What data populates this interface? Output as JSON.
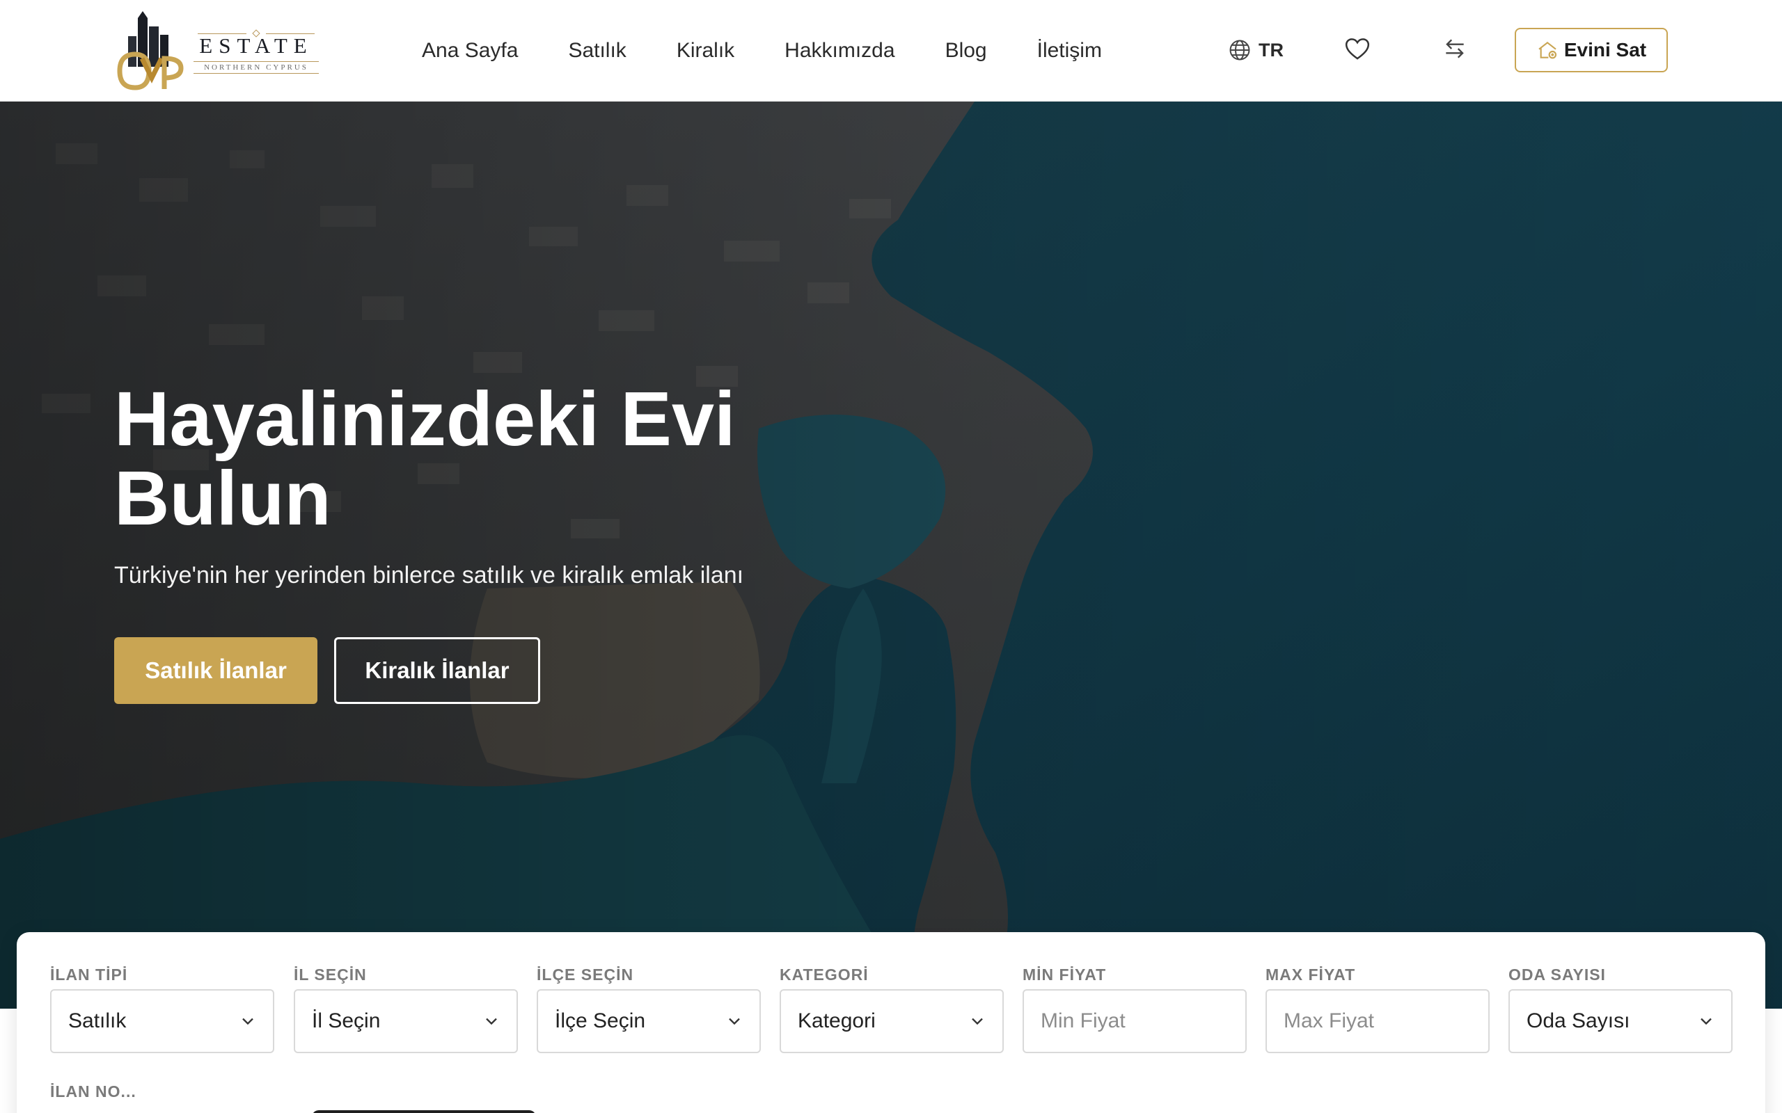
{
  "brand": {
    "name": "ESTATE",
    "subtitle": "NORTHERN CYPRUS",
    "colors": {
      "gold": "#c9a553",
      "dark": "#1a1d24"
    }
  },
  "nav": {
    "items": [
      {
        "label": "Ana Sayfa"
      },
      {
        "label": "Satılık"
      },
      {
        "label": "Kiralık"
      },
      {
        "label": "Hakkımızda"
      },
      {
        "label": "Blog"
      },
      {
        "label": "İletişim"
      }
    ]
  },
  "header_actions": {
    "language": "TR",
    "language_icon": "globe-icon",
    "favorites_icon": "heart-icon",
    "compare_icon": "swap-arrows-icon",
    "sell_button": "Evini Sat",
    "sell_icon": "house-icon"
  },
  "hero": {
    "title": "Hayalinizdeki Evi Bulun",
    "subtitle": "Türkiye'nin her yerinden binlerce satılık ve kiralık emlak ilanı",
    "primary_button": "Satılık İlanlar",
    "secondary_button": "Kiralık İlanlar"
  },
  "search": {
    "fields": [
      {
        "label": "İLAN TİPİ",
        "value": "Satılık",
        "type": "select"
      },
      {
        "label": "İL SEÇİN",
        "value": "İl Seçin",
        "type": "select"
      },
      {
        "label": "İLÇE SEÇİN",
        "value": "İlçe Seçin",
        "type": "select"
      },
      {
        "label": "KATEGORİ",
        "value": "Kategori",
        "type": "select"
      },
      {
        "label": "MİN FİYAT",
        "placeholder": "Min Fiyat",
        "type": "input"
      },
      {
        "label": "MAX FİYAT",
        "placeholder": "Max Fiyat",
        "type": "input"
      },
      {
        "label": "ODA SAYISI",
        "value": "Oda Sayısı",
        "type": "select"
      }
    ],
    "ilan_no_label": "İLAN NO..."
  }
}
